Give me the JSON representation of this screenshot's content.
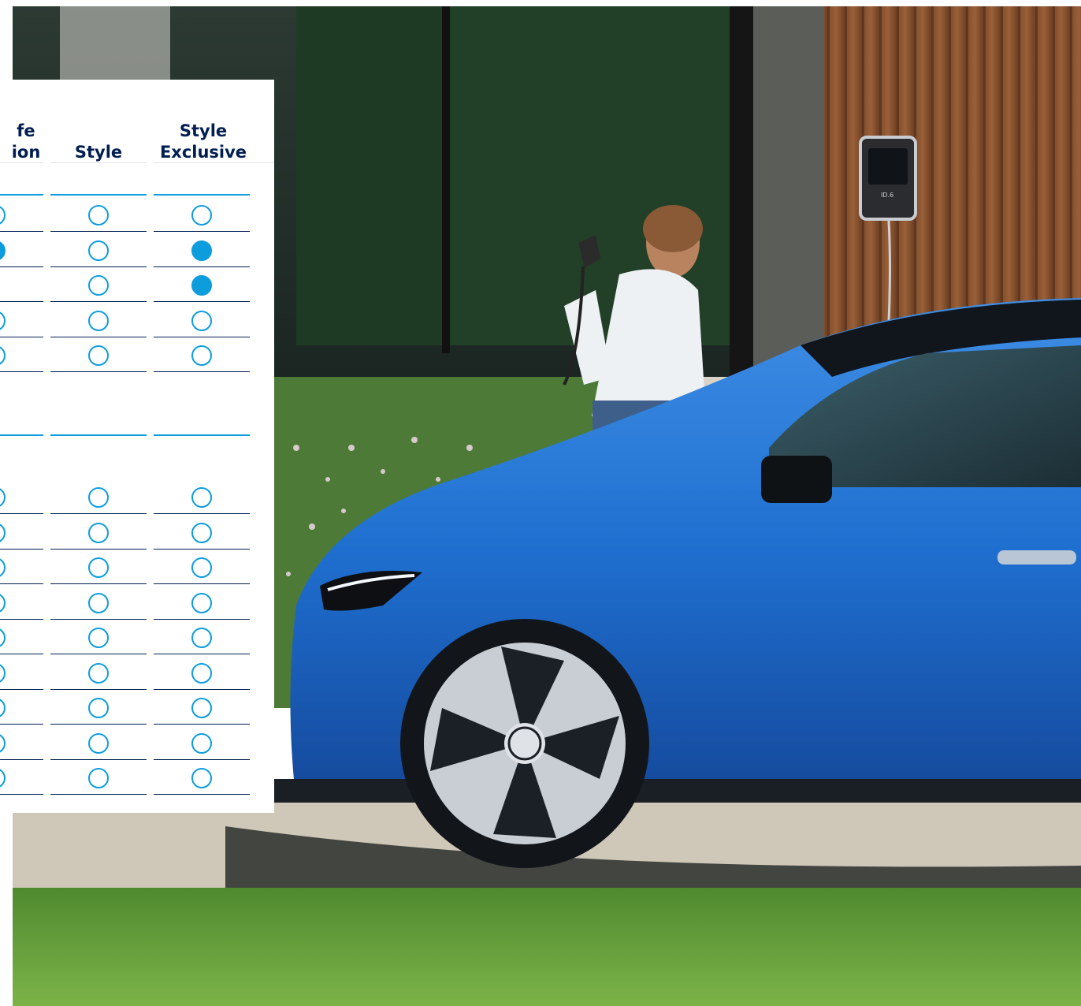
{
  "colors": {
    "accent": "#0d9ddd",
    "navy": "#001e50",
    "car_blue": "#1f6fd0"
  },
  "panel": {
    "columns": [
      {
        "id": "col-life-edition",
        "label_lines": [
          "fe",
          "ion"
        ]
      },
      {
        "id": "col-style",
        "label_lines": [
          "Style"
        ]
      },
      {
        "id": "col-style-exclusive",
        "label_lines": [
          "Style",
          "Exclusive"
        ]
      }
    ],
    "section_1": {
      "rows": [
        {
          "values": [
            "empty",
            "empty",
            "empty"
          ]
        },
        {
          "values": [
            "filled",
            "empty",
            "filled"
          ]
        },
        {
          "values": [
            "none",
            "empty",
            "filled"
          ]
        },
        {
          "values": [
            "empty",
            "empty",
            "empty"
          ]
        },
        {
          "values": [
            "empty",
            "empty",
            "empty"
          ]
        }
      ]
    },
    "section_2": {
      "rows": [
        {
          "values": [
            "empty",
            "empty",
            "empty"
          ]
        },
        {
          "values": [
            "empty",
            "empty",
            "empty"
          ]
        },
        {
          "values": [
            "empty",
            "empty",
            "empty"
          ]
        },
        {
          "values": [
            "empty",
            "empty",
            "empty"
          ]
        },
        {
          "values": [
            "empty",
            "empty",
            "empty"
          ]
        },
        {
          "values": [
            "empty",
            "empty",
            "empty"
          ]
        },
        {
          "values": [
            "empty",
            "empty",
            "empty"
          ]
        },
        {
          "values": [
            "empty",
            "empty",
            "empty"
          ]
        },
        {
          "values": [
            "empty",
            "empty",
            "empty"
          ]
        }
      ]
    }
  },
  "scene": {
    "wallbox_label": "ID.6",
    "icons": [
      "vw-logo-icon",
      "wallbox-icon",
      "charging-plug-icon"
    ]
  }
}
